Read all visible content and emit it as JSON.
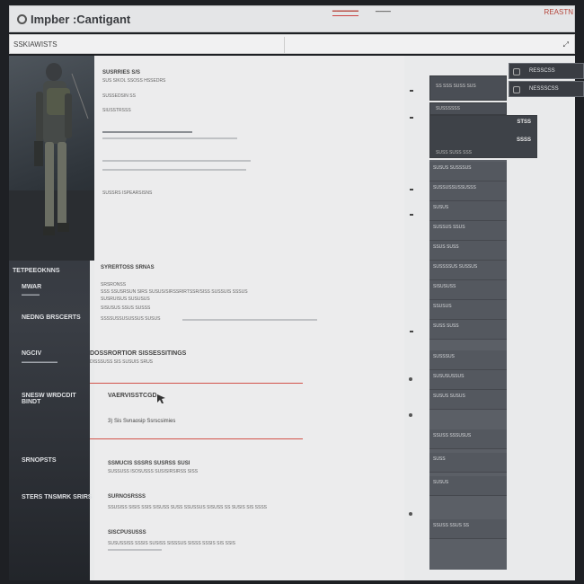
{
  "app": {
    "title": "Impber :Cantigant",
    "top_tab_active": "━━━━━━",
    "top_tab_other": "━━━━",
    "top_right": "REASTN"
  },
  "subbar": {
    "label": "SSKIAWISTS",
    "right_label": "⤢"
  },
  "hero": {
    "image": "soldier-image"
  },
  "left_nav": {
    "sections": [
      {
        "label": "TETPEEOKNNS",
        "sub": ""
      },
      {
        "label": "MWAR",
        "sub": "▬▬▬▬"
      },
      {
        "label": "NEDNG BRSCERTS",
        "sub": ""
      },
      {
        "label": "NGCIV",
        "sub": "▬▬▬▬▬▬▬▬"
      },
      {
        "label": "SNESW WRDCDIT BINDT",
        "sub": ""
      },
      {
        "label": "SRNOPSTS",
        "sub": ""
      },
      {
        "label": "STERS TNSMRK SRIRS",
        "sub": ""
      }
    ]
  },
  "content": {
    "top_block": {
      "line1": "SUSRRIES S/S",
      "line2": "SUS SIKOL SSOSS HSSEDRS",
      "line3": "SUSSEDSIN SS",
      "line4": "SIUSSTRSSS",
      "line5": "SUSSRS ISPEARSISNS"
    },
    "section2": {
      "heading": "SYRERTOSS SRNAS",
      "sub1": "SRSRONSS",
      "sub2": "SSS SSUSRSUN SIRS SUSUS/SIRSSRIRTSSR/SISS SUSSUIS SSSUS",
      "sub3": "SUSRUISUS SUSUSUS",
      "sub4": "SISUSUS SSUS SUSSS",
      "sub5": "SSSSUSSUSUSSUS SUSUS"
    },
    "section3": {
      "heading": "DOSSRORTIOR SISSESSITINGS",
      "sub": "DISSSUSS SIS SUSUIS SRUS"
    },
    "row1": {
      "label": "VAERVISSTCGD",
      "icon": "cursor-icon"
    },
    "row2": {
      "label": "3) Sis Svnaosip Ssrscsimies"
    },
    "section4": {
      "heading": "SSMUCIS SSSRS SUSRSS SUSI",
      "sub": "SUSSUSS ISOSUSSS SUSISIRSIRSS SISS"
    },
    "section5": {
      "heading": "SURNOSRSSS",
      "sub": "SSUSISS SISIS SSIS SISUSS SUSS SSUSSUS SISUSS SS SUSIS SIS SSSS"
    },
    "section6": {
      "heading": "SISCPUSUSSS",
      "sub": "SUSUSSISS SSSIS SUSISS SISSSUS SISSS SSSIS SIS SSIS"
    }
  },
  "right_top": {
    "toast1": "RESSCSS",
    "toast2": "NESSSCSS",
    "panel1": "SS SSS SUSS SUS",
    "panel2": "SUSSSSSS",
    "panel3_label": "STSS",
    "panel3_value": "SSSS",
    "panel3_sub": "SUSS SUSS SSS"
  },
  "right_list": [
    "SUSUS SUSSSUS",
    "SUSSUSSUSSUSSS",
    "SUSUS",
    "SUSSUS SSUS",
    "SSUS SUSS",
    "SUSSSSUS SUSSUS",
    "SISUSUSS",
    "SSUSUS",
    "SUSS SUSS",
    "SUSSSUS",
    "SUSUSUSSUS",
    "SUSUS SUSUS",
    "SSUSS SSSUSUS",
    "SUSS",
    "SUSUS",
    "SSUSS SSUS SS"
  ]
}
